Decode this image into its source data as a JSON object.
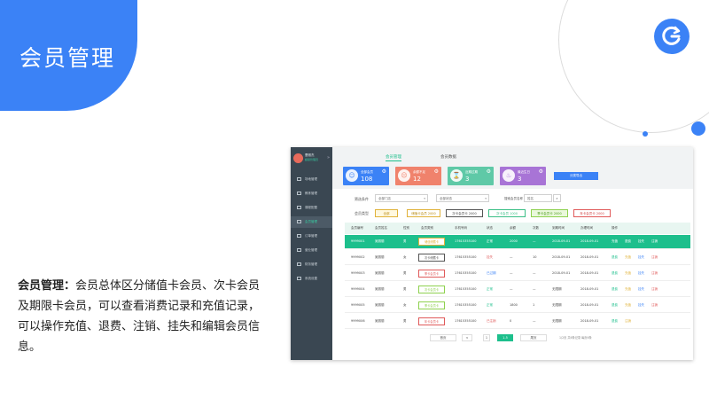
{
  "slide": {
    "title": "会员管理",
    "desc_bold": "会员管理：",
    "desc_text": "会员总体区分储值卡会员、次卡会员及期限卡会员，可以查看消费记录和充值记录，可以操作充值、退费、注销、挂失和编辑会员信息。"
  },
  "colors": {
    "accent": "#3b82f6",
    "green": "#1dbf8c",
    "sidebar": "#3a4752"
  },
  "app": {
    "user": {
      "name": "曹雅杰",
      "role": "超级管理员"
    },
    "sidebar": [
      {
        "label": "场地管理",
        "icon": "grid-icon"
      },
      {
        "label": "教练管理",
        "icon": "coach-icon"
      },
      {
        "label": "课程配置",
        "icon": "course-icon"
      },
      {
        "label": "会员管理",
        "icon": "member-icon"
      },
      {
        "label": "订单管理",
        "icon": "order-icon"
      },
      {
        "label": "营业管理",
        "icon": "business-icon"
      },
      {
        "label": "财务管理",
        "icon": "finance-icon"
      },
      {
        "label": "系统设置",
        "icon": "settings-icon"
      }
    ],
    "tabs": [
      "会员管理",
      "会员数据"
    ],
    "stats": [
      {
        "label": "全部会员",
        "value": "108",
        "color": "#3b82f6",
        "icon": "person-icon"
      },
      {
        "label": "余额不足",
        "value": "12",
        "color": "#f0826c",
        "icon": "sad-face-icon"
      },
      {
        "label": "近期过期",
        "value": "3",
        "color": "#5fc9a7",
        "icon": "hourglass-icon"
      },
      {
        "label": "最近生日",
        "value": "3",
        "color": "#a874d6",
        "icon": "cake-icon"
      }
    ],
    "export_label": "分类导出",
    "filter": {
      "label": "筛选条件",
      "store": "全部门店",
      "status": "全部状态",
      "search_label": "搜索会员名称",
      "search_value": "姓名"
    },
    "type_label": "会员类型",
    "chips": [
      {
        "label": "全部",
        "border": "#e0b23a",
        "text": "#b88a10",
        "fill": "#fff8e0"
      },
      {
        "label": "储值卡会员 2000",
        "border": "#e0b23a",
        "text": "#b88a10",
        "fill": "#fff"
      },
      {
        "label": "次卡会员卡 2000",
        "border": "#555555",
        "text": "#444",
        "fill": "#fff"
      },
      {
        "label": "次卡会员 1000",
        "border": "#3bbf86",
        "text": "#3bbf86",
        "fill": "#fff"
      },
      {
        "label": "季卡会员卡 2000",
        "border": "#8ed14f",
        "text": "#4a9a1a",
        "fill": "#eaf8dc"
      },
      {
        "label": "年卡会员卡 2000",
        "border": "#e05a5a",
        "text": "#d04040",
        "fill": "#fff"
      }
    ],
    "columns": [
      "会员编号",
      "会员姓名",
      "性别",
      "会员类别",
      "手机号码",
      "状态",
      "余额",
      "次数",
      "到期时间",
      "办理时间",
      "操作"
    ],
    "rows": [
      {
        "id": "9999001",
        "name": "吴丽丽",
        "sex": "男",
        "type": "储值储蓄卡",
        "type_color": "#e0b23a",
        "phone": "17615355100",
        "status": "正常",
        "status_color": "#fff",
        "balance": "2000",
        "count": "—",
        "expire": "2018-09-01",
        "join": "2018-09-01",
        "actions": [
          "充值",
          "退费",
          "挂失",
          "注销"
        ]
      },
      {
        "id": "9999002",
        "name": "吴丽丽",
        "sex": "女",
        "type": "次卡储蓄卡",
        "type_color": "#555555",
        "phone": "17615355100",
        "status": "挂失",
        "status_color": "#e05a5a",
        "balance": "—",
        "count": "10",
        "expire": "2018-09-01",
        "join": "2018-09-01",
        "actions": [
          "退费",
          "充值",
          "挂失",
          "注销"
        ]
      },
      {
        "id": "9999003",
        "name": "吴丽丽",
        "sex": "男",
        "type": "季卡会员卡",
        "type_color": "#e05a5a",
        "phone": "17615355100",
        "status": "已过期",
        "status_color": "#3b82f6",
        "balance": "—",
        "count": "—",
        "expire": "2018-09-01",
        "join": "2018-09-01",
        "actions": [
          "退费",
          "充值",
          "挂失",
          "注销"
        ]
      },
      {
        "id": "9999004",
        "name": "吴丽丽",
        "sex": "男",
        "type": "次卡会员卡",
        "type_color": "#8ed14f",
        "phone": "17615355100",
        "status": "正常",
        "status_color": "#1dbf8c",
        "balance": "—",
        "count": "—",
        "expire": "无限期",
        "join": "2018-09-01",
        "actions": [
          "退费",
          "充值",
          "挂失",
          "注销"
        ]
      },
      {
        "id": "9999005",
        "name": "吴丽丽",
        "sex": "女",
        "type": "季卡会员卡",
        "type_color": "#8ed14f",
        "phone": "17615355100",
        "status": "正常",
        "status_color": "#1dbf8c",
        "balance": "1800",
        "count": "1",
        "expire": "无限期",
        "join": "2018-09-01",
        "actions": [
          "退费",
          "充值",
          "挂失",
          "注销"
        ]
      },
      {
        "id": "9999006",
        "name": "吴丽丽",
        "sex": "男",
        "type": "年卡会员卡",
        "type_color": "#e05a5a",
        "phone": "17615355100",
        "status": "已注销",
        "status_color": "#e05a5a",
        "balance": "0",
        "count": "—",
        "expire": "无限期",
        "join": "2018-09-01",
        "actions": [
          "退费",
          "注销"
        ]
      }
    ],
    "pagination": {
      "first": "首页",
      "prev": "<",
      "current": "1",
      "next": "1-5",
      "last": "尾页",
      "info": "1/2页  共6条记录  每页6条"
    }
  }
}
